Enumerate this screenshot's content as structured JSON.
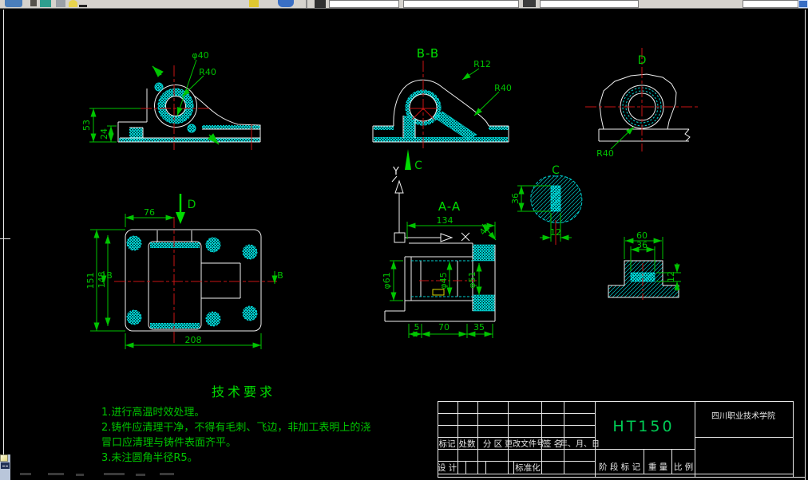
{
  "toolbar": {
    "icons": [
      "app-icon",
      "palette-icon",
      "snap-icon",
      "layer-icon",
      "color-icon",
      "zoom-icon",
      "view-icon",
      "pen-icon",
      "grid-icon"
    ]
  },
  "views": {
    "front": {
      "phi40": "φ40",
      "r40": "R40",
      "d53": "53",
      "d24": "24"
    },
    "section_bb": {
      "title": "B-B",
      "r12": "R12",
      "r40": "R40"
    },
    "view_d": {
      "title": "D",
      "r40": "R40"
    },
    "plan": {
      "label_d": "D",
      "b_left": "B",
      "b_right": "B",
      "d76": "76",
      "d151": "151",
      "d148": "148",
      "d208": "208"
    },
    "section_aa": {
      "title": "A-A",
      "label_c": "C",
      "label_y": "Y",
      "d134": "134",
      "d43": "43",
      "phi61": "φ61",
      "phi45": "φ45",
      "phi51": "φ51",
      "d5": "5",
      "d70": "70",
      "d35": "35"
    },
    "detail_c": {
      "title": "C",
      "d36": "36",
      "d12": "12"
    },
    "detail_right": {
      "d60": "60",
      "d36": "36",
      "d12": "12"
    }
  },
  "tech_requirements": {
    "title": "技术要求",
    "lines": [
      "1.进行高温时效处理。",
      "2.铸件应清理干净，不得有毛刺、飞边，非加工表明上的浇",
      "冒口应清理与铸件表面齐平。",
      "3.未注圆角半径R5。"
    ]
  },
  "title_block": {
    "material": "HT150",
    "company": "四川职业技术学院",
    "col_headers": [
      "标记",
      "处数",
      "分 区",
      "更改文件号",
      "签 名",
      "年、月、日"
    ],
    "row_design": "设 计",
    "row_standard": "标准化",
    "stage_label": "阶 段 标 记",
    "weight_label": "重 量",
    "scale_label": "比 例"
  }
}
